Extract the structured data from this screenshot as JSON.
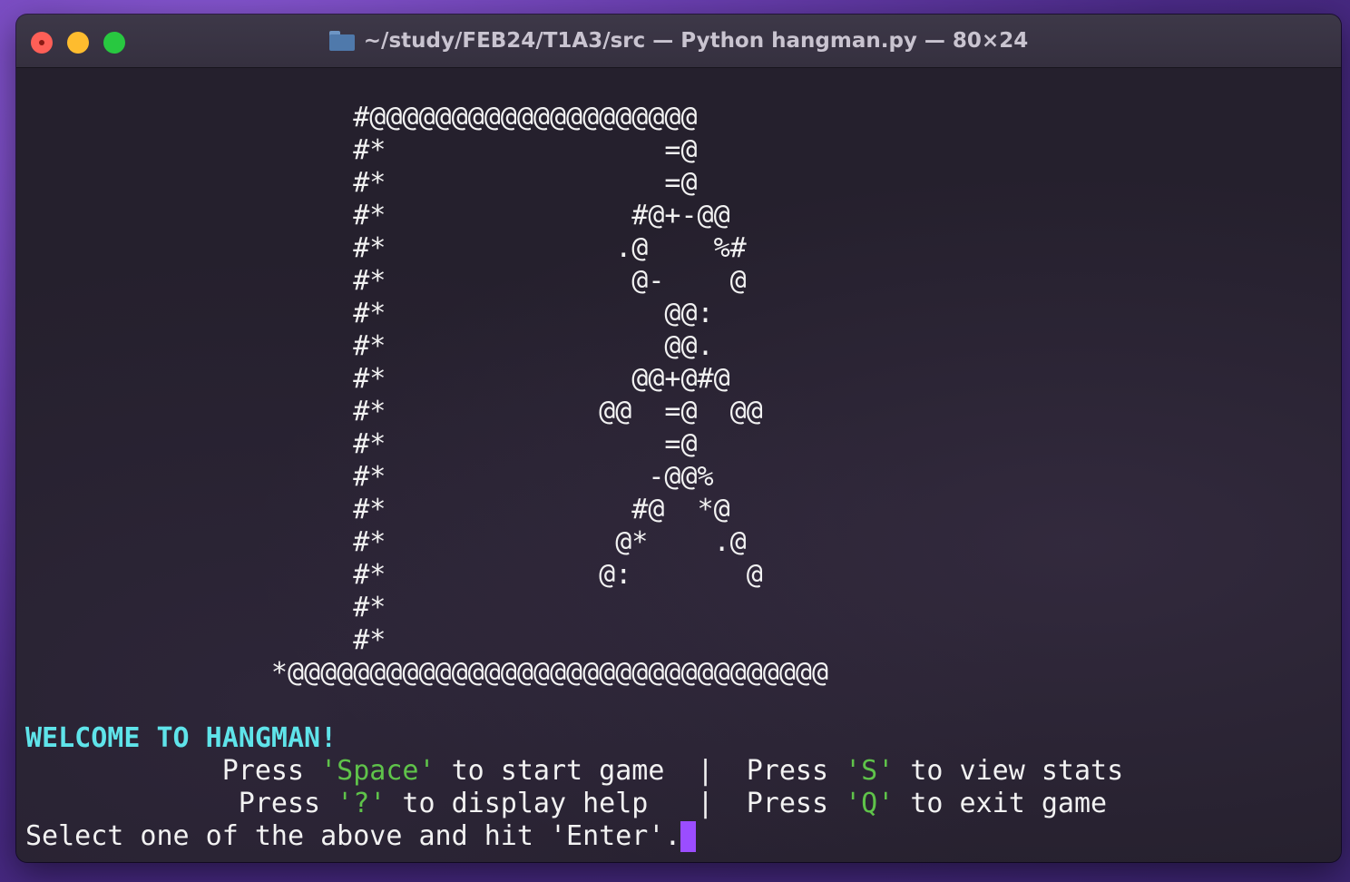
{
  "window": {
    "title": "~/study/FEB24/T1A3/src — Python hangman.py — 80×24",
    "folder_icon": "folder-icon",
    "traffic_lights": {
      "close_color": "#fe5f57",
      "minimize_color": "#febc2e",
      "maximize_color": "#28c840"
    }
  },
  "terminal": {
    "ascii_art": [
      "                    #@@@@@@@@@@@@@@@@@@@@",
      "                    #*                 =@",
      "                    #*                 =@",
      "                    #*               #@+-@@",
      "                    #*              .@    %#",
      "                    #*               @-    @",
      "                    #*                 @@:",
      "                    #*                 @@.",
      "                    #*               @@+@#@",
      "                    #*             @@  =@  @@",
      "                    #*                 =@",
      "                    #*                -@@%",
      "                    #*               #@  *@",
      "                    #*              @*    .@",
      "                    #*             @:       @",
      "                    #*",
      "                    #*",
      "               *@@@@@@@@@@@@@@@@@@@@@@@@@@@@@@@@@"
    ],
    "welcome": "WELCOME TO HANGMAN!",
    "menu_row1": {
      "prefix": "            Press ",
      "key_a": "'Space'",
      "middle": " to start game  |  Press ",
      "key_b": "'S'",
      "suffix": " to view stats"
    },
    "menu_row2": {
      "prefix": "             Press ",
      "key_a": "'?'",
      "middle": " to display help   |  Press ",
      "key_b": "'Q'",
      "suffix": " to exit game"
    },
    "prompt": "Select one of the above and hit 'Enter'.",
    "colors": {
      "welcome": "#5fe4ea",
      "key": "#5fc34a",
      "cursor": "#9b4dff"
    }
  }
}
